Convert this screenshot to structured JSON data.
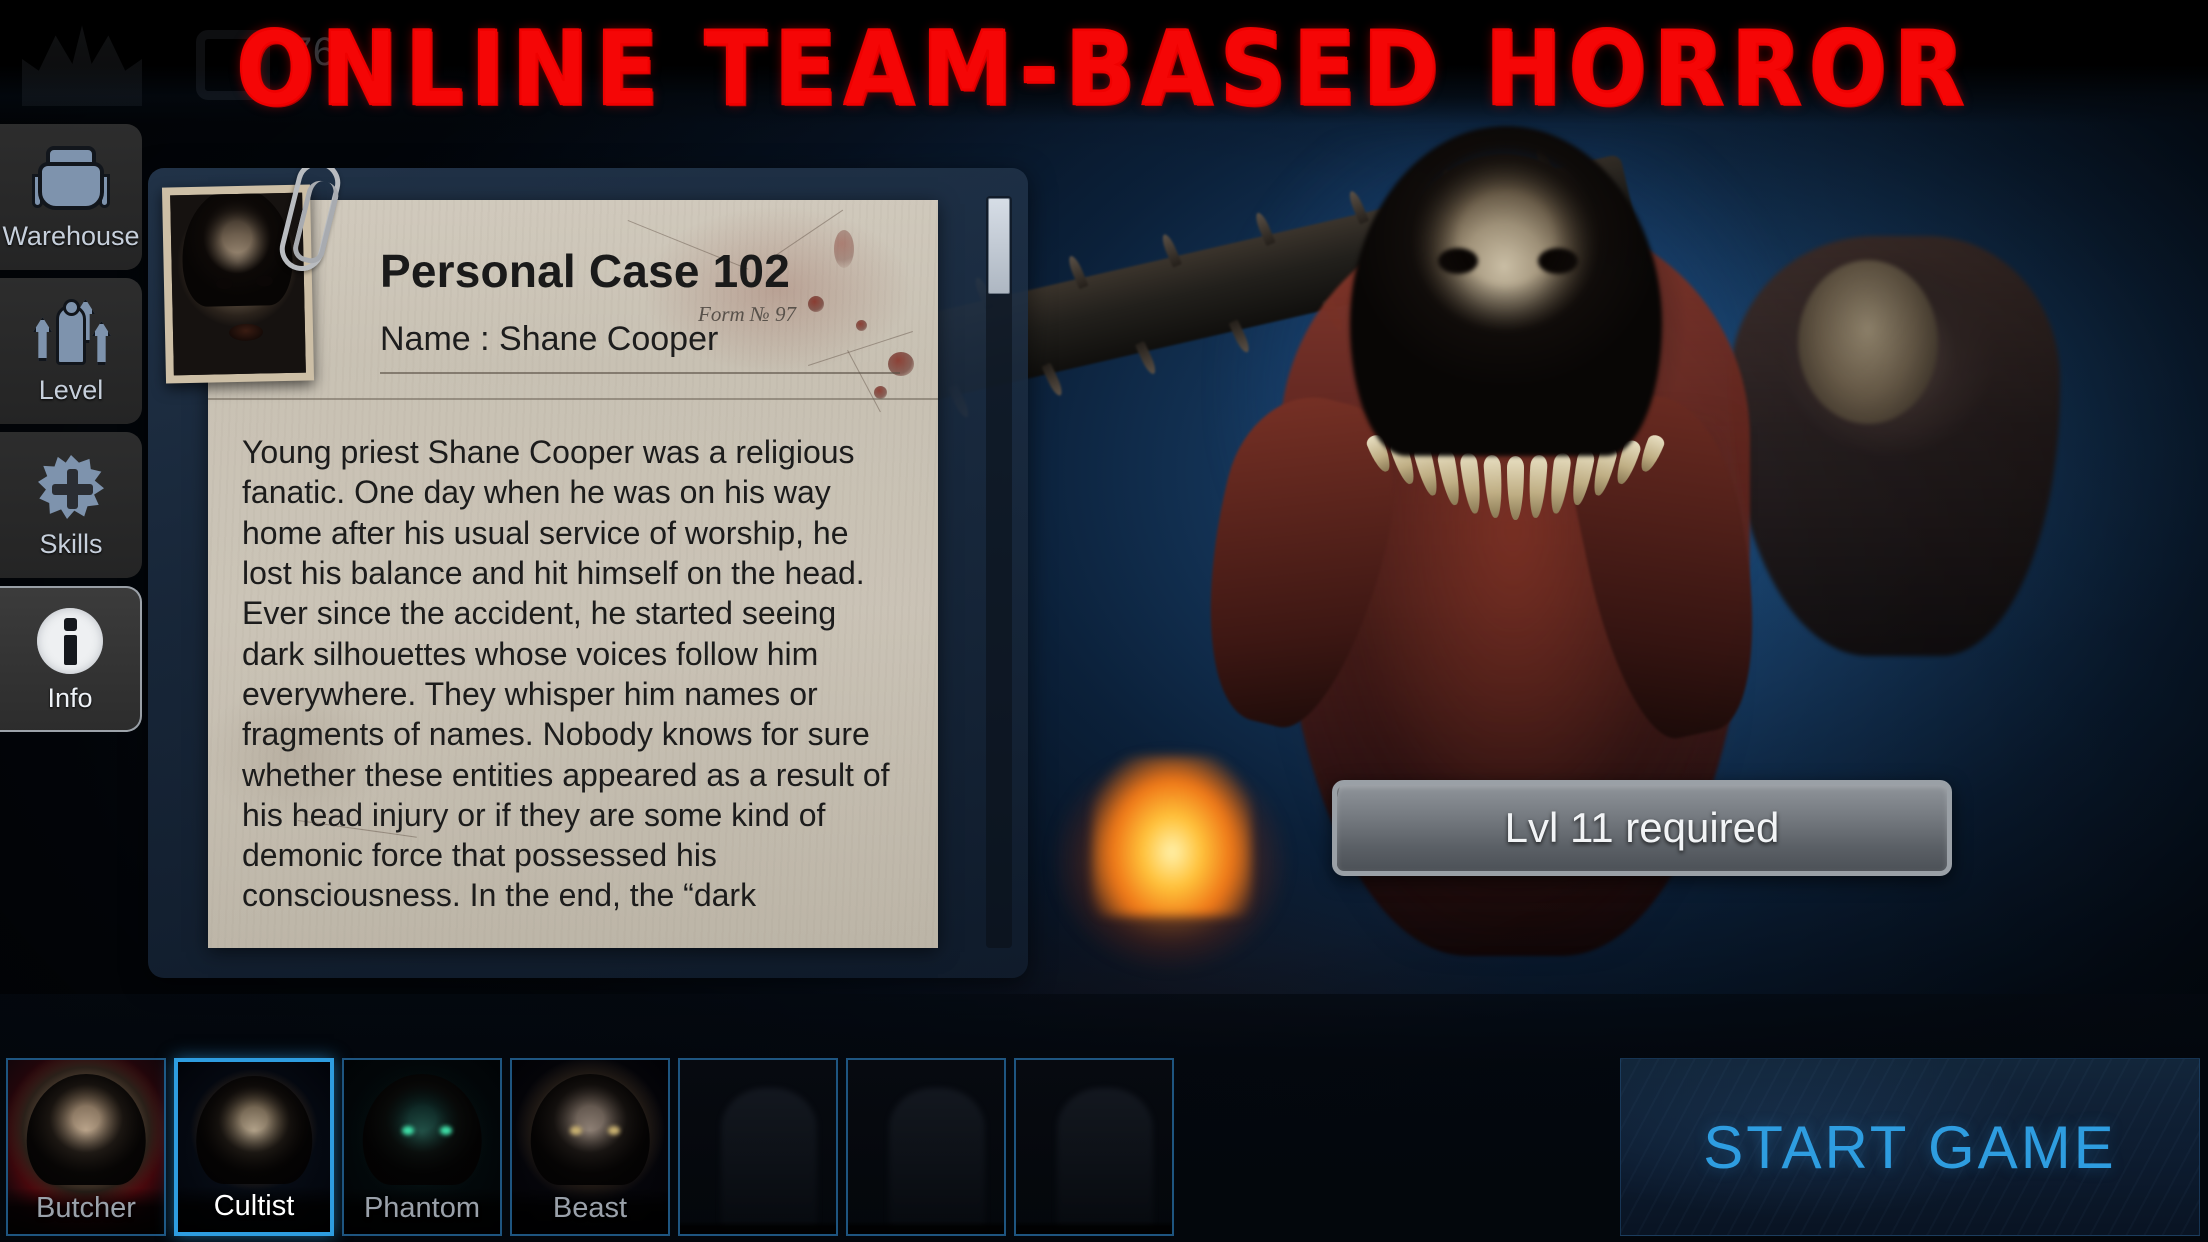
{
  "game": {
    "tagline": "ONLINE TEAM-BASED HORROR",
    "currency_count": "76"
  },
  "sidebar": {
    "items": [
      {
        "label": "Warehouse",
        "icon": "backpack-icon",
        "selected": false
      },
      {
        "label": "Level",
        "icon": "level-up-icon",
        "selected": false
      },
      {
        "label": "Skills",
        "icon": "skill-splat-icon",
        "selected": false
      },
      {
        "label": "Info",
        "icon": "info-circle-icon",
        "selected": true
      }
    ]
  },
  "case_file": {
    "title": "Personal Case 102",
    "form_label": "Form № 97",
    "name_label": "Name : Shane Cooper",
    "photo_alt": "cultist-portrait-photo",
    "description": "Young priest Shane Cooper was a religious fanatic. One day when he was on his way home after his usual service of worship, he lost his balance and hit himself on the head. Ever since the accident, he started seeing dark silhouettes whose voices follow him everywhere. They whisper him names or fragments of names. Nobody knows for sure whether these entities appeared as a result of his head injury or if they are some kind of demonic force that possessed his consciousness. In the end, the “dark"
  },
  "level_requirement": {
    "text": "Lvl 11 required"
  },
  "characters": [
    {
      "name": "Butcher",
      "selected": false,
      "locked": false,
      "art": "art-butcher"
    },
    {
      "name": "Cultist",
      "selected": true,
      "locked": false,
      "art": "art-cultist"
    },
    {
      "name": "Phantom",
      "selected": false,
      "locked": false,
      "art": "art-phantom"
    },
    {
      "name": "Beast",
      "selected": false,
      "locked": false,
      "art": "art-beast"
    },
    {
      "name": "",
      "selected": false,
      "locked": true,
      "art": ""
    },
    {
      "name": "",
      "selected": false,
      "locked": true,
      "art": ""
    },
    {
      "name": "",
      "selected": false,
      "locked": true,
      "art": ""
    }
  ],
  "actions": {
    "start_game_label": "START GAME"
  },
  "colors": {
    "title_red": "#f50606",
    "accent_blue": "#2e9de0",
    "slot_border": "#1e5580",
    "sidebar_bg": "#303030",
    "paper": "#c7c0b2"
  }
}
